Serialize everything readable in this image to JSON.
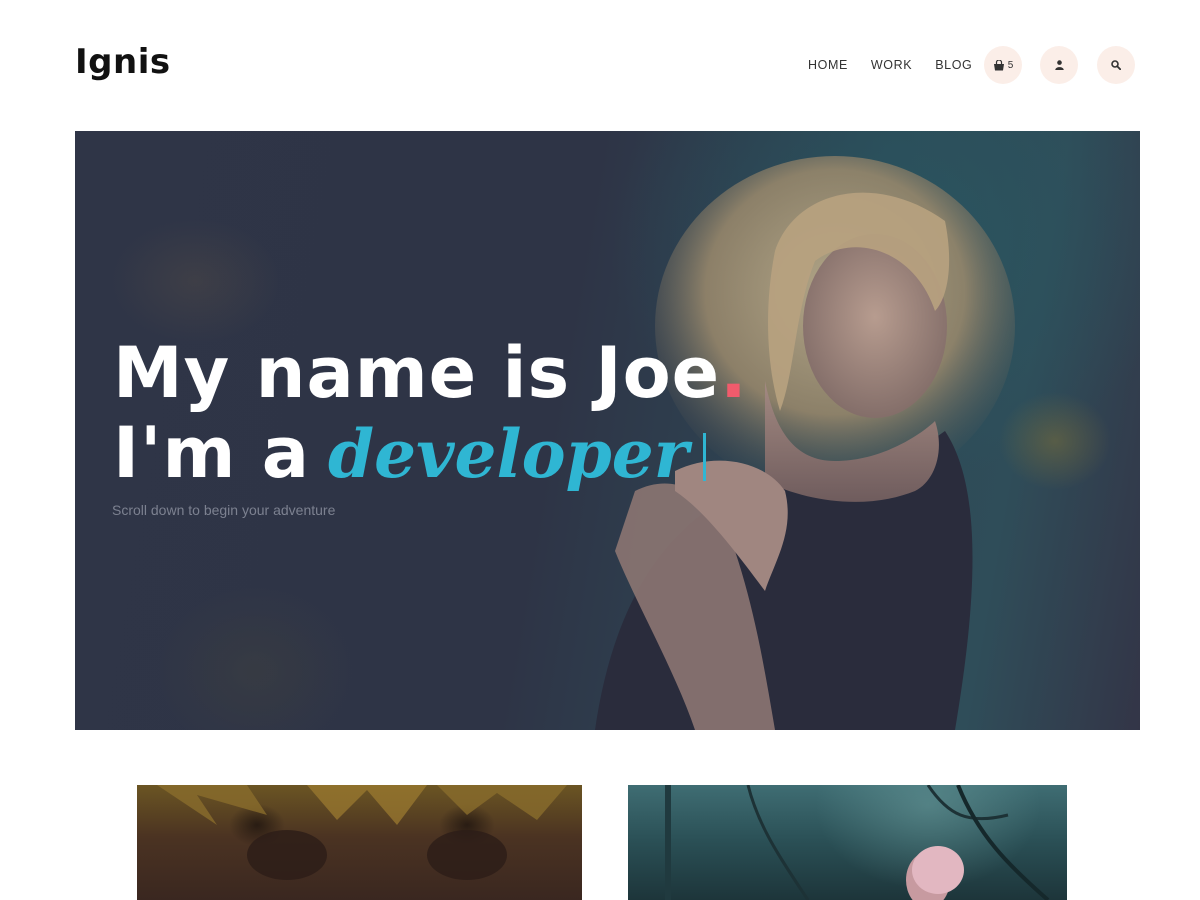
{
  "brand": {
    "name": "Ignis"
  },
  "nav": {
    "items": [
      {
        "label": "HOME"
      },
      {
        "label": "WORK"
      },
      {
        "label": "BLOG"
      }
    ],
    "cart_count": "5",
    "cart_icon": "shopping-bag-icon",
    "user_icon": "user-icon",
    "search_icon": "search-icon"
  },
  "hero": {
    "line1": "My name is Joe",
    "line1_punct": ".",
    "line2_prefix": "I'm a",
    "role": "developer",
    "subtitle": "Scroll down to begin your adventure",
    "accent_color": "#2fb6d3",
    "dot_color": "#f15b6c"
  },
  "colors": {
    "icon_button_bg": "#fbeee8",
    "hero_bg": "#2f3547"
  }
}
